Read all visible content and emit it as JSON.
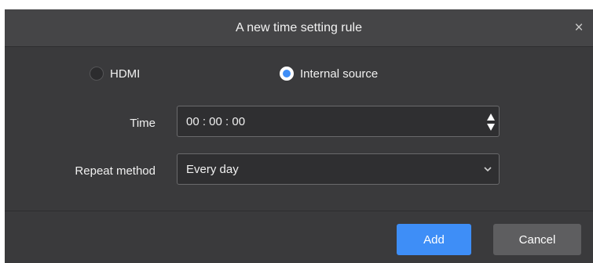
{
  "dialog": {
    "title": "A new time setting rule",
    "close_label": "×"
  },
  "source": {
    "options": [
      {
        "label": "HDMI",
        "checked": false
      },
      {
        "label": "Internal source",
        "checked": true
      }
    ]
  },
  "time": {
    "label": "Time",
    "value": "00 : 00 : 00"
  },
  "repeat": {
    "label": "Repeat method",
    "selected": "Every day"
  },
  "footer": {
    "add_label": "Add",
    "cancel_label": "Cancel"
  },
  "colors": {
    "accent": "#3e8ef7",
    "dialog_bg": "#3a3a3c",
    "titlebar_bg": "#454547"
  },
  "icons": {
    "close": "close-icon",
    "spin_up": "arrow-up-icon",
    "spin_down": "arrow-down-icon",
    "dropdown": "chevron-down-icon"
  }
}
